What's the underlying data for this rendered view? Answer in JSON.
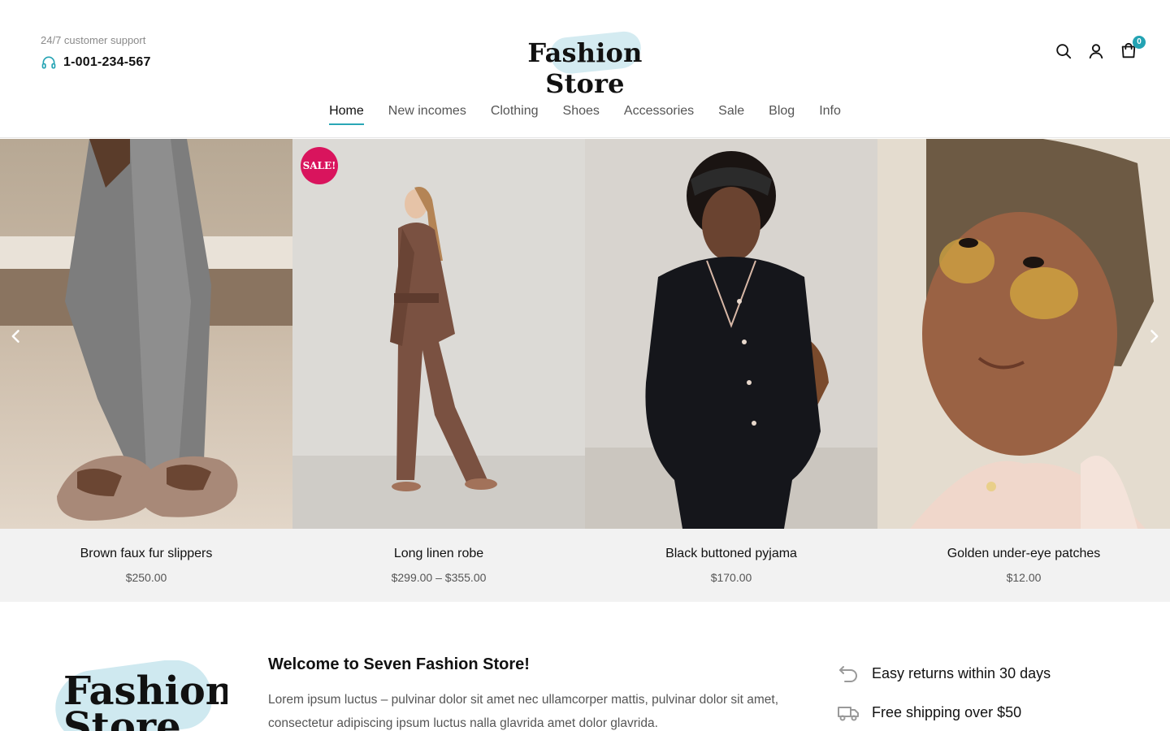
{
  "header": {
    "support_label": "24/7 customer support",
    "support_phone": "1-001-234-567",
    "logo_text": "Fashion Store",
    "cart_count": "0",
    "accent_color": "#2aa7b6"
  },
  "nav": {
    "items": [
      {
        "label": "Home",
        "active": true
      },
      {
        "label": "New incomes"
      },
      {
        "label": "Clothing"
      },
      {
        "label": "Shoes"
      },
      {
        "label": "Accessories"
      },
      {
        "label": "Sale"
      },
      {
        "label": "Blog"
      },
      {
        "label": "Info"
      }
    ]
  },
  "products": [
    {
      "name": "Brown faux fur slippers",
      "price": "$250.00"
    },
    {
      "name": "Long linen robe",
      "price": "$299.00 – $355.00",
      "badge": "SALE!"
    },
    {
      "name": "Black buttoned pyjama",
      "price": "$170.00"
    },
    {
      "name": "Golden under-eye patches",
      "price": "$12.00"
    }
  ],
  "info": {
    "logo_line1": "Fashion",
    "logo_line2": "Store",
    "welcome_title": "Welcome to Seven Fashion Store!",
    "welcome_text": "Lorem ipsum luctus – pulvinar dolor sit amet nec ullamcorper mattis, pulvinar dolor sit amet, consectetur adipiscing ipsum luctus nalla glavrida amet dolor glavrida.",
    "features": [
      {
        "icon": "return-icon",
        "label": "Easy returns within 30 days"
      },
      {
        "icon": "truck-icon",
        "label": "Free shipping over $50"
      }
    ]
  },
  "colors": {
    "sale_badge": "#d9145d",
    "brush": "#cfe9f0"
  }
}
